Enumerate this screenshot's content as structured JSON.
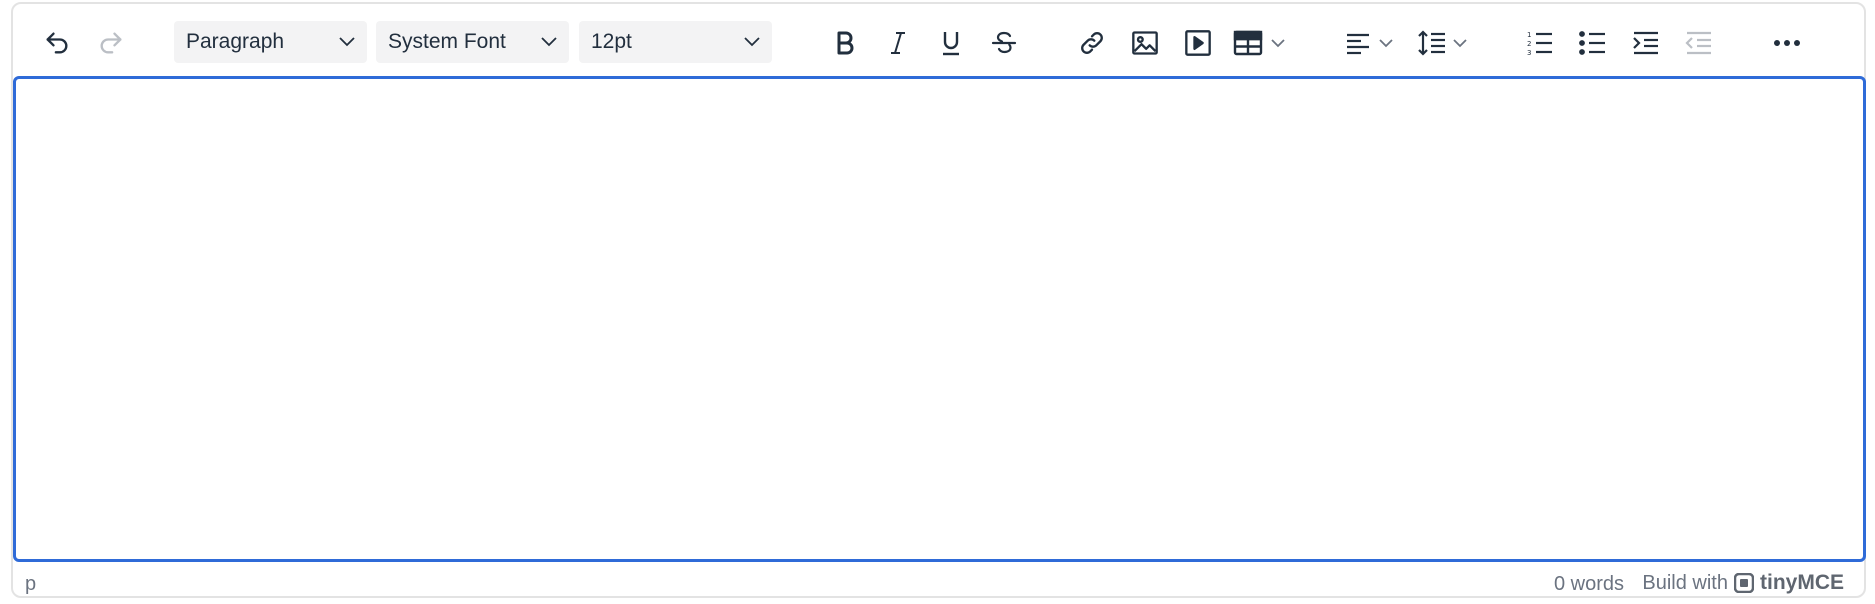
{
  "toolbar": {
    "undo_icon": "undo-icon",
    "redo_icon": "redo-icon",
    "block_format": "Paragraph",
    "font_family": "System Font",
    "font_size": "12pt",
    "icons": [
      "bold-icon",
      "italic-icon",
      "underline-icon",
      "strikethrough-icon",
      "link-icon",
      "image-icon",
      "media-icon",
      "table-icon",
      "align-left-icon",
      "line-height-icon",
      "ordered-list-icon",
      "unordered-list-icon",
      "indent-icon",
      "outdent-icon",
      "more-icon"
    ]
  },
  "editor": {
    "content": ""
  },
  "statusbar": {
    "path": "p",
    "word_count": "0 words",
    "build_with": "Build with",
    "brand": "tinyMCE"
  },
  "colors": {
    "icon": "#222f3e",
    "focus_border": "#2f6bd8",
    "select_bg": "#f3f3f4",
    "status_text": "#6b7380"
  }
}
